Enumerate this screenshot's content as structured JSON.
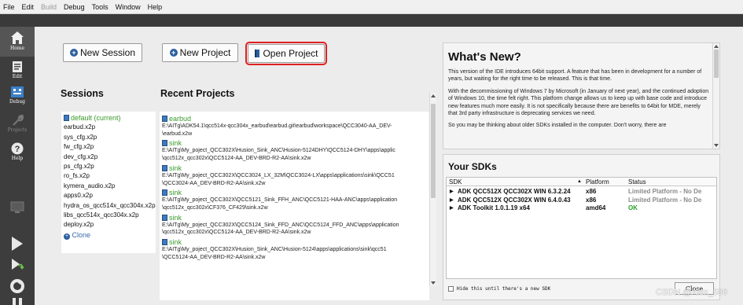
{
  "menu": [
    "File",
    "Edit",
    "Build",
    "Debug",
    "Tools",
    "Window",
    "Help"
  ],
  "sidebar": {
    "home": "Home",
    "edit": "Edit",
    "debug": "Debug",
    "projects": "Projects",
    "help": "Help"
  },
  "buttons": {
    "new_session": "New Session",
    "new_project": "New Project",
    "open_project": "Open Project"
  },
  "sessions": {
    "heading": "Sessions",
    "items": [
      "default (current)",
      "earbud.x2p",
      "sys_cfg.x2p",
      "fw_cfg.x2p",
      "dev_cfg.x2p",
      "ps_cfg.x2p",
      "ro_fs.x2p",
      "kymera_audio.x2p",
      "apps0.x2p",
      "hydra_os_qcc514x_qcc304x.x2p",
      "libs_qcc514x_qcc304x.x2p",
      "deploy.x2p"
    ],
    "clone": "Clone"
  },
  "recent": {
    "heading": "Recent Projects",
    "items": [
      {
        "name": "earbud",
        "path1": "E:\\AITg\\ADK54.1\\qcc514x-qcc304x_earbud\\earbud.git\\earbud\\workspace\\QCC3040-AA_DEV-",
        "path2": "\\earbud.x2w"
      },
      {
        "name": "sink",
        "path1": "E:\\AITg\\My_poject_QCC302X\\Husion_Sink_ANC\\Husion-5124DHY\\QCC5124-DHY\\apps\\applic",
        "path2": "\\qcc512x_qcc302x\\QCC5124-AA_DEV-BRD-R2-AA\\sink.x2w"
      },
      {
        "name": "sink",
        "path1": "E:\\AITg\\My_poject_QCC302X\\QCC3024_LX_32M\\QCC3024-LX\\apps\\applications\\sink\\QCC51",
        "path2": "\\QCC3024-AA_DEV-BRD-R2-AA\\sink.x2w"
      },
      {
        "name": "sink",
        "path1": "E:\\AITg\\My_poject_QCC302X\\QCC5121_Sink_FFH_ANC\\QCC5121-HAA-ANC\\apps\\application",
        "path2": "\\qcc512x_qcc302x\\CF376_CF429\\sink.x2w"
      },
      {
        "name": "sink",
        "path1": "E:\\AITg\\My_poject_QCC302X\\QCC5124_Sink_FFD_ANC\\QCC5124_FFD_ANC\\apps\\application",
        "path2": "\\qcc512x_qcc302x\\QCC5124-AA_DEV-BRD-R2-AA\\sink.x2w"
      },
      {
        "name": "sink",
        "path1": "E:\\AITg\\My_poject_QCC302X\\Husion_Sink_ANC\\Husion-5124\\apps\\applications\\sink\\qcc51",
        "path2": "\\QCC5124-AA_DEV-BRD-R2-AA\\sink.x2w"
      }
    ]
  },
  "whats_new": {
    "title": "What's New?",
    "paragraphs": [
      "This version of the IDE introduces 64bit support. A feature that has been in development for a number of years, but waiting for the right time to be released. This is that time.",
      "With the decommissioning of Windows 7 by Microsoft (in January of next year), and the continued adoption of Windows 10, the time felt right. This platform change allows us to keep up with base code and introduce new features much more easily. It is not specifically because there are benefits to 64bit for MDE, merely that 3rd party infrastructure is deprecating services we need.",
      "So you may be thinking about older SDKs installed in the computer. Don't worry, there are"
    ]
  },
  "sdks": {
    "title": "Your SDKs",
    "columns": {
      "sdk": "SDK",
      "platform": "Platform",
      "status": "Status"
    },
    "rows": [
      {
        "name": "ADK QCC512X QCC302X WIN 6.3.2.24",
        "platform": "x86",
        "status": "Limited Platform - No De",
        "kind": "limited"
      },
      {
        "name": "ADK QCC512X QCC302X WIN 6.4.0.43",
        "platform": "x86",
        "status": "Limited Platform - No De",
        "kind": "limited"
      },
      {
        "name": "ADK Toolkit 1.0.1.19 x64",
        "platform": "amd64",
        "status": "OK",
        "kind": "ok"
      }
    ],
    "hide_label": "Hide this until there's a new SDK",
    "close_label": "Close"
  },
  "watermark": "CSDN @Alex_586",
  "colors": {
    "accent_green": "#3a9a2a",
    "highlight_red": "#e02020",
    "sidebar": "#3d3d3d"
  }
}
